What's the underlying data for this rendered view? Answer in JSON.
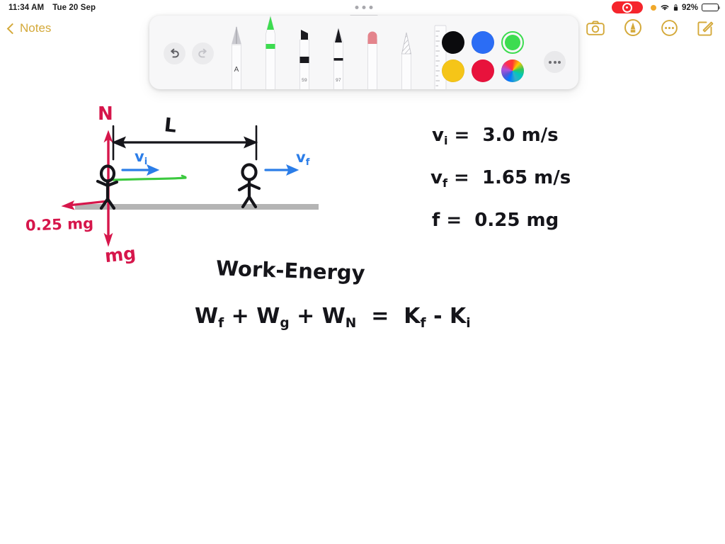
{
  "status_bar": {
    "time": "11:34 AM",
    "date": "Tue 20 Sep",
    "recording_icon": "screen-record-icon",
    "privacy_dot": "orange-privacy-dot",
    "wifi_icon": "wifi-icon",
    "lock_icon": "lock-icon",
    "battery_percent": "92%",
    "battery_level": 92
  },
  "nav": {
    "back_label": "Notes",
    "back_chevron_icon": "chevron-left-icon",
    "icons": [
      {
        "name": "camera-icon",
        "label": "Camera"
      },
      {
        "name": "markup-icon",
        "label": "Markup"
      },
      {
        "name": "more-icon",
        "label": "More"
      },
      {
        "name": "compose-icon",
        "label": "New Note"
      }
    ]
  },
  "toolbar": {
    "grabber_icon": "drag-handle-dots",
    "undo": {
      "name": "undo-icon",
      "label": "Undo",
      "enabled": true
    },
    "redo": {
      "name": "redo-icon",
      "label": "Redo",
      "enabled": false
    },
    "more_label": "More tools",
    "tools": [
      {
        "name": "fountain-pen-tool",
        "label": "Fountain Pen",
        "badge": "A",
        "selected": false
      },
      {
        "name": "highlighter-tool",
        "label": "Highlighter",
        "badge": "",
        "selected": true
      },
      {
        "name": "marker-tool",
        "label": "Marker",
        "badge": "59",
        "selected": false
      },
      {
        "name": "pen-tool",
        "label": "Pen",
        "badge": "97",
        "selected": false
      },
      {
        "name": "eraser-tool",
        "label": "Eraser",
        "badge": "",
        "selected": false
      },
      {
        "name": "lasso-tool",
        "label": "Lasso",
        "badge": "",
        "selected": false
      },
      {
        "name": "ruler-tool",
        "label": "Ruler",
        "badge": "",
        "selected": false
      }
    ],
    "colors": [
      {
        "name": "swatch-black",
        "hex": "#0b0b0d",
        "selected": false
      },
      {
        "name": "swatch-blue",
        "hex": "#2b6df5",
        "selected": false
      },
      {
        "name": "swatch-green",
        "hex": "#3ddc50",
        "selected": true
      },
      {
        "name": "swatch-yellow",
        "hex": "#f5c518",
        "selected": false
      },
      {
        "name": "swatch-red",
        "hex": "#e8123c",
        "selected": false
      },
      {
        "name": "swatch-color-wheel",
        "hex": "rainbow",
        "selected": false
      }
    ]
  },
  "note": {
    "ink_colors": {
      "red": "#d6164b",
      "blue": "#2b7de8",
      "black": "#15151a",
      "green_highlight": "#3cc93f",
      "ground_gray": "#b4b4b4"
    },
    "diagram_labels": {
      "normal_force": "N",
      "distance": "L",
      "velocity_initial": "v",
      "velocity_initial_sub": "i",
      "velocity_final": "v",
      "velocity_final_sub": "f",
      "friction": "0.25 mg",
      "weight": "mg"
    },
    "givens": [
      {
        "lhs": "v",
        "lhs_sub": "i",
        "eq": "=",
        "rhs": "3.0 m/s"
      },
      {
        "lhs": "v",
        "lhs_sub": "f",
        "eq": "=",
        "rhs": "1.65 m/s"
      },
      {
        "lhs": "f",
        "lhs_sub": "",
        "eq": "=",
        "rhs": "0.25 mg"
      }
    ],
    "work_energy": {
      "heading": "Work-Energy",
      "equation_parts": [
        {
          "base": "W",
          "sub": "f"
        },
        {
          "base": "+",
          "sub": ""
        },
        {
          "base": "W",
          "sub": "g"
        },
        {
          "base": "+",
          "sub": ""
        },
        {
          "base": "W",
          "sub": "N"
        },
        {
          "base": "=",
          "sub": ""
        },
        {
          "base": "K",
          "sub": "f"
        },
        {
          "base": "-",
          "sub": ""
        },
        {
          "base": "K",
          "sub": "i"
        }
      ],
      "equation_text": "Wf + Wg + WN = Kf - Ki"
    }
  }
}
